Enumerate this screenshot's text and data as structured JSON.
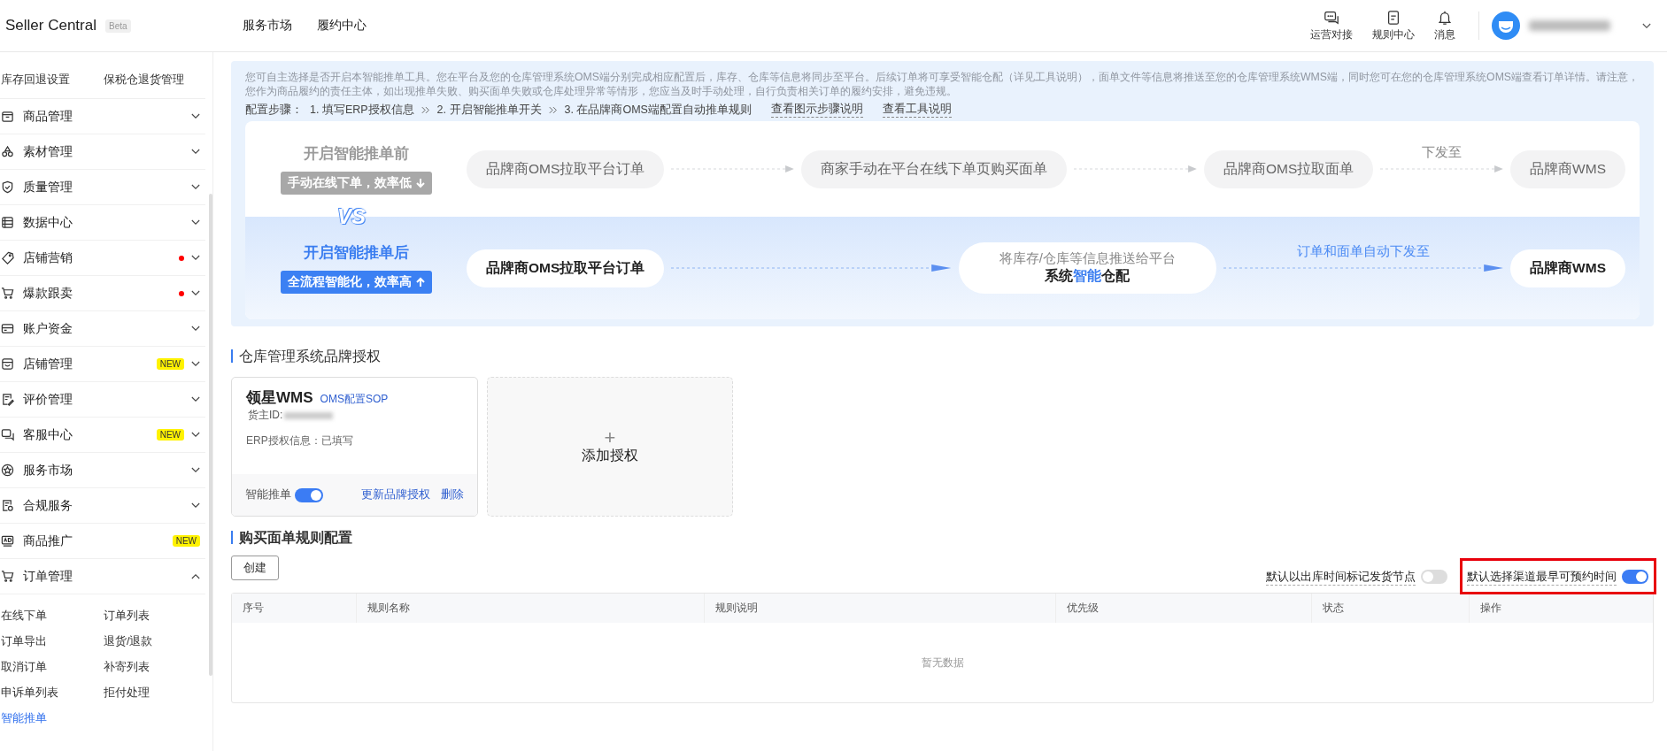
{
  "header": {
    "logo": "Seller Central",
    "badge": "Beta",
    "nav": [
      "服务市场",
      "履约中心"
    ],
    "actions": [
      {
        "label": "运营对接"
      },
      {
        "label": "规则中心"
      },
      {
        "label": "消息"
      }
    ]
  },
  "sidebar": {
    "top_links": [
      "库存回退设置",
      "保税仓退货管理"
    ],
    "items": [
      {
        "label": "商品管理",
        "expanded": false,
        "expandable": true,
        "dot": false
      },
      {
        "label": "素材管理",
        "expanded": false,
        "expandable": true,
        "dot": false
      },
      {
        "label": "质量管理",
        "expanded": false,
        "expandable": true,
        "dot": false
      },
      {
        "label": "数据中心",
        "expanded": false,
        "expandable": true,
        "dot": false
      },
      {
        "label": "店铺营销",
        "expanded": false,
        "expandable": true,
        "dot": true
      },
      {
        "label": "爆款跟卖",
        "expanded": false,
        "expandable": true,
        "dot": true
      },
      {
        "label": "账户资金",
        "expanded": false,
        "expandable": true,
        "dot": false
      },
      {
        "label": "店铺管理",
        "expanded": false,
        "expandable": true,
        "dot": false,
        "badge": "NEW"
      },
      {
        "label": "评价管理",
        "expanded": false,
        "expandable": true,
        "dot": false
      },
      {
        "label": "客服中心",
        "expanded": false,
        "expandable": true,
        "dot": false,
        "badge": "NEW"
      },
      {
        "label": "服务市场",
        "expanded": false,
        "expandable": true,
        "dot": false
      },
      {
        "label": "合规服务",
        "expanded": false,
        "expandable": true,
        "dot": false
      },
      {
        "label": "商品推广",
        "expanded": false,
        "expandable": false,
        "dot": false,
        "badge": "NEW"
      },
      {
        "label": "订单管理",
        "expanded": true,
        "expandable": true,
        "dot": false
      }
    ],
    "sub_links": [
      {
        "label": "在线下单",
        "selected": false
      },
      {
        "label": "订单列表",
        "selected": false
      },
      {
        "label": "订单导出",
        "selected": false
      },
      {
        "label": "退货/退款",
        "selected": false
      },
      {
        "label": "取消订单",
        "selected": false
      },
      {
        "label": "补寄列表",
        "selected": false
      },
      {
        "label": "申诉单列表",
        "selected": false
      },
      {
        "label": "拒付处理",
        "selected": false
      },
      {
        "label": "智能推单",
        "selected": true
      }
    ]
  },
  "banner": {
    "intro": "您可自主选择是否开启本智能推单工具。您在平台及您的仓库管理系统OMS端分别完成相应配置后，库存、仓库等信息将同步至平台。后续订单将可享受智能仓配（详见工具说明），面单文件等信息将推送至您的仓库管理系统WMS端，同时您可在您的仓库管理系统OMS端查看订单详情。请注意，您作为商品履约的责任主体，如出现推单失败、购买面单失败或仓库处理异常等情形，您应当及时手动处理，自行负责相关订单的履约安排，避免违规。",
    "steps_label": "配置步骤：",
    "steps": [
      "1. 填写ERP授权信息",
      "2. 开启智能推单开关",
      "3. 在品牌商OMS端配置自动推单规则"
    ],
    "links": [
      "查看图示步骤说明",
      "查看工具说明"
    ]
  },
  "flow": {
    "vs": "VS",
    "before": {
      "title": "开启智能推单前",
      "tag": "手动在线下单，效率低",
      "steps": [
        {
          "text": "品牌商OMS拉取平台订单"
        },
        {
          "text": "商家手动在平台在线下单页购买面单"
        },
        {
          "text": "品牌商OMS拉取面单"
        },
        {
          "text": "品牌商WMS",
          "arrow_label": "下发至"
        }
      ]
    },
    "after": {
      "title": "开启智能推单后",
      "tag": "全流程智能化，效率高",
      "steps": [
        {
          "text": "品牌商OMS拉取平台订单"
        },
        {
          "caption": "将库存/仓库等信息推送给平台",
          "segments": [
            {
              "text": "系统",
              "accent": false
            },
            {
              "text": "智能",
              "accent": true
            },
            {
              "text": "仓配",
              "accent": false
            }
          ]
        },
        {
          "text": "品牌商WMS",
          "arrow_label": "订单和面单自动下发至"
        }
      ]
    }
  },
  "auth": {
    "title": "仓库管理系统品牌授权",
    "cards": [
      {
        "name": "领星WMS",
        "link": "OMS配置SOP",
        "owner_label": "货主ID:",
        "erp": "ERP授权信息：已填写",
        "toggle_label": "智能推单",
        "on": true,
        "actions": [
          "更新品牌授权",
          "删除"
        ]
      }
    ],
    "add_label": "添加授权",
    "add_icon": "+"
  },
  "rules": {
    "title": "购买面单规则配置",
    "create": "创建",
    "toggles": [
      {
        "label": "默认以出库时间标记发货节点",
        "on": false,
        "highlighted": false
      },
      {
        "label": "默认选择渠道最早可预约时间",
        "on": true,
        "highlighted": true
      }
    ],
    "columns": [
      "序号",
      "规则名称",
      "规则说明",
      "优先级",
      "状态",
      "操作"
    ],
    "empty": "暂无数据"
  }
}
